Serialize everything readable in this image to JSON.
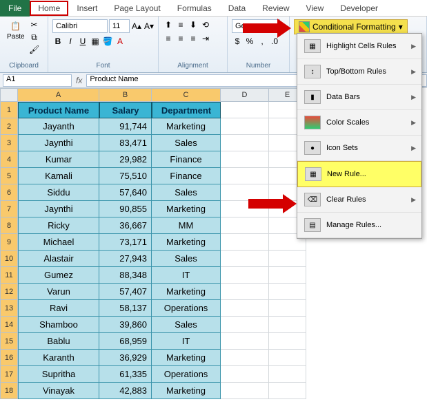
{
  "tabs": {
    "file": "File",
    "home": "Home",
    "insert": "Insert",
    "pageLayout": "Page Layout",
    "formulas": "Formulas",
    "data": "Data",
    "review": "Review",
    "view": "View",
    "developer": "Developer"
  },
  "ribbon": {
    "clipboard": {
      "label": "Clipboard",
      "paste": "Paste"
    },
    "font": {
      "label": "Font",
      "name": "Calibri",
      "size": "11"
    },
    "alignment": {
      "label": "Alignment"
    },
    "number": {
      "label": "Number",
      "format": "Ge"
    },
    "cf": {
      "label": "Conditional Formatting"
    }
  },
  "menu": {
    "highlight": "Highlight Cells Rules",
    "topbottom": "Top/Bottom Rules",
    "databars": "Data Bars",
    "colorscales": "Color Scales",
    "iconsets": "Icon Sets",
    "newrule": "New Rule...",
    "clearrules": "Clear Rules",
    "managerules": "Manage Rules..."
  },
  "namebox": "A1",
  "formula": "Product Name",
  "columns": [
    "A",
    "B",
    "C",
    "D",
    "E"
  ],
  "headers": {
    "c0": "Product Name",
    "c1": "Salary",
    "c2": "Department"
  },
  "rows": [
    {
      "n": "1"
    },
    {
      "n": "2",
      "c0": "Jayanth",
      "c1": "91,744",
      "c2": "Marketing"
    },
    {
      "n": "3",
      "c0": "Jaynthi",
      "c1": "83,471",
      "c2": "Sales"
    },
    {
      "n": "4",
      "c0": "Kumar",
      "c1": "29,982",
      "c2": "Finance"
    },
    {
      "n": "5",
      "c0": "Kamali",
      "c1": "75,510",
      "c2": "Finance"
    },
    {
      "n": "6",
      "c0": "Siddu",
      "c1": "57,640",
      "c2": "Sales"
    },
    {
      "n": "7",
      "c0": "Jaynthi",
      "c1": "90,855",
      "c2": "Marketing"
    },
    {
      "n": "8",
      "c0": "Ricky",
      "c1": "36,667",
      "c2": "MM"
    },
    {
      "n": "9",
      "c0": "Michael",
      "c1": "73,171",
      "c2": "Marketing"
    },
    {
      "n": "10",
      "c0": "Alastair",
      "c1": "27,943",
      "c2": "Sales"
    },
    {
      "n": "11",
      "c0": "Gumez",
      "c1": "88,348",
      "c2": "IT"
    },
    {
      "n": "12",
      "c0": "Varun",
      "c1": "57,407",
      "c2": "Marketing"
    },
    {
      "n": "13",
      "c0": "Ravi",
      "c1": "58,137",
      "c2": "Operations"
    },
    {
      "n": "14",
      "c0": "Shamboo",
      "c1": "39,860",
      "c2": "Sales"
    },
    {
      "n": "15",
      "c0": "Bablu",
      "c1": "68,959",
      "c2": "IT"
    },
    {
      "n": "16",
      "c0": "Karanth",
      "c1": "36,929",
      "c2": "Marketing"
    },
    {
      "n": "17",
      "c0": "Supritha",
      "c1": "61,335",
      "c2": "Operations"
    },
    {
      "n": "18",
      "c0": "Vinayak",
      "c1": "42,883",
      "c2": "Marketing"
    }
  ],
  "chart_data": {
    "type": "table",
    "columns": [
      "Product Name",
      "Salary",
      "Department"
    ],
    "data": [
      [
        "Jayanth",
        91744,
        "Marketing"
      ],
      [
        "Jaynthi",
        83471,
        "Sales"
      ],
      [
        "Kumar",
        29982,
        "Finance"
      ],
      [
        "Kamali",
        75510,
        "Finance"
      ],
      [
        "Siddu",
        57640,
        "Sales"
      ],
      [
        "Jaynthi",
        90855,
        "Marketing"
      ],
      [
        "Ricky",
        36667,
        "MM"
      ],
      [
        "Michael",
        73171,
        "Marketing"
      ],
      [
        "Alastair",
        27943,
        "Sales"
      ],
      [
        "Gumez",
        88348,
        "IT"
      ],
      [
        "Varun",
        57407,
        "Marketing"
      ],
      [
        "Ravi",
        58137,
        "Operations"
      ],
      [
        "Shamboo",
        39860,
        "Sales"
      ],
      [
        "Bablu",
        68959,
        "IT"
      ],
      [
        "Karanth",
        36929,
        "Marketing"
      ],
      [
        "Supritha",
        61335,
        "Operations"
      ],
      [
        "Vinayak",
        42883,
        "Marketing"
      ]
    ]
  }
}
